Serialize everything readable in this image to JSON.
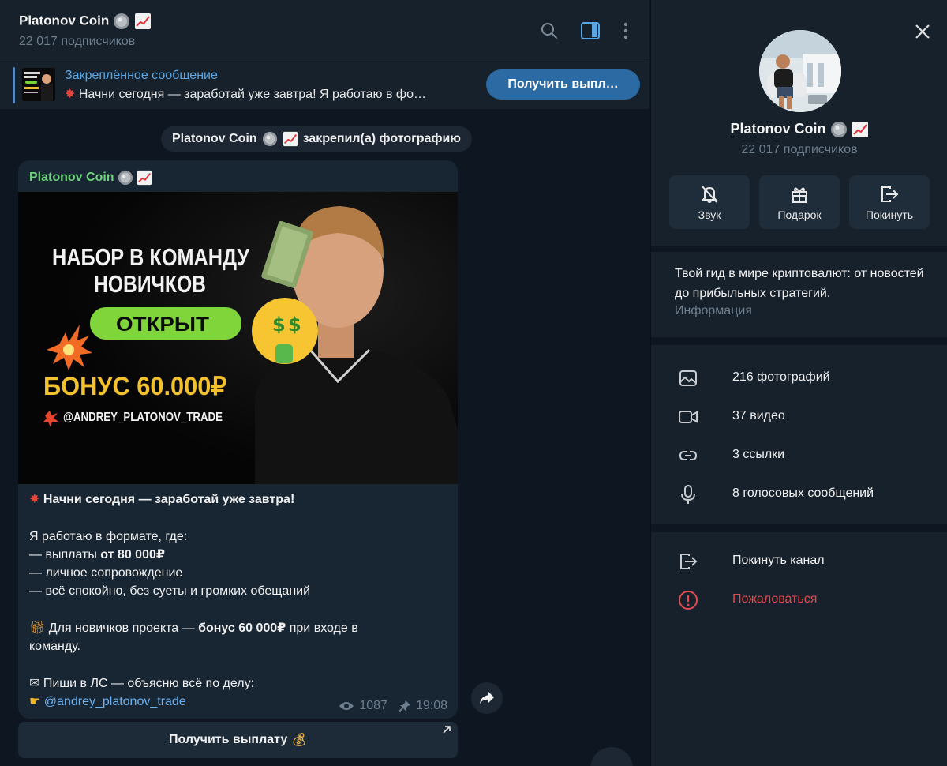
{
  "chat": {
    "title": "Platonov Coin",
    "subscribers": "22 017 подписчиков",
    "pinned": {
      "label": "Закреплённое сообщение",
      "text": "Начни сегодня — заработай уже завтра!  Я работаю в фо…",
      "button": "Получить выпл…",
      "thumb_text": "НАБОР В КОМАНДУ"
    },
    "service_message": "закрепил(а) фотографию",
    "service_author": "Platonov Coin",
    "post": {
      "author": "Platonov Coin",
      "photo": {
        "headline_1": "НАБОР В КОМАНДУ",
        "headline_2": "НОВИЧКОВ",
        "badge": "ОТКРЫТ",
        "bonus": "БОНУС 60.000₽",
        "handle": "@ANDREY_PLATONOV_TRADE"
      },
      "lines": {
        "l1": "Начни сегодня — заработай уже завтра!",
        "l2": "Я работаю в формате, где:",
        "l3a": "— выплаты ",
        "l3b": "от 80 000₽",
        "l4": "— личное сопровождение",
        "l5": "— всё спокойно, без суеты и громких обещаний",
        "l6a": "Для новичков проекта — ",
        "l6b": "бонус 60 000₽",
        "l6c": " при входе в",
        "l7": "команду.",
        "l8": "Пиши в ЛС — объясню всё по делу:",
        "l9": "@andrey_platonov_trade"
      },
      "views": "1087",
      "time": "19:08"
    },
    "inline_button": "Получить выплату"
  },
  "panel": {
    "name": "Platonov Coin",
    "subscribers": "22 017 подписчиков",
    "actions": {
      "mute": "Звук",
      "gift": "Подарок",
      "leave": "Покинуть"
    },
    "description": "Твой гид в мире криптовалют: от новостей до прибыльных стратегий.",
    "description_label": "Информация",
    "media": {
      "photos": "216 фотографий",
      "videos": "37 видео",
      "links": "3 ссылки",
      "voice": "8 голосовых сообщений"
    },
    "leave_channel": "Покинуть канал",
    "report": "Пожаловаться"
  },
  "colors": {
    "accent": "#5288c1",
    "link": "#6ab2f2",
    "author": "#6fd17e",
    "danger": "#e14a4e",
    "background": "#0e1621",
    "surface": "#17212b"
  }
}
